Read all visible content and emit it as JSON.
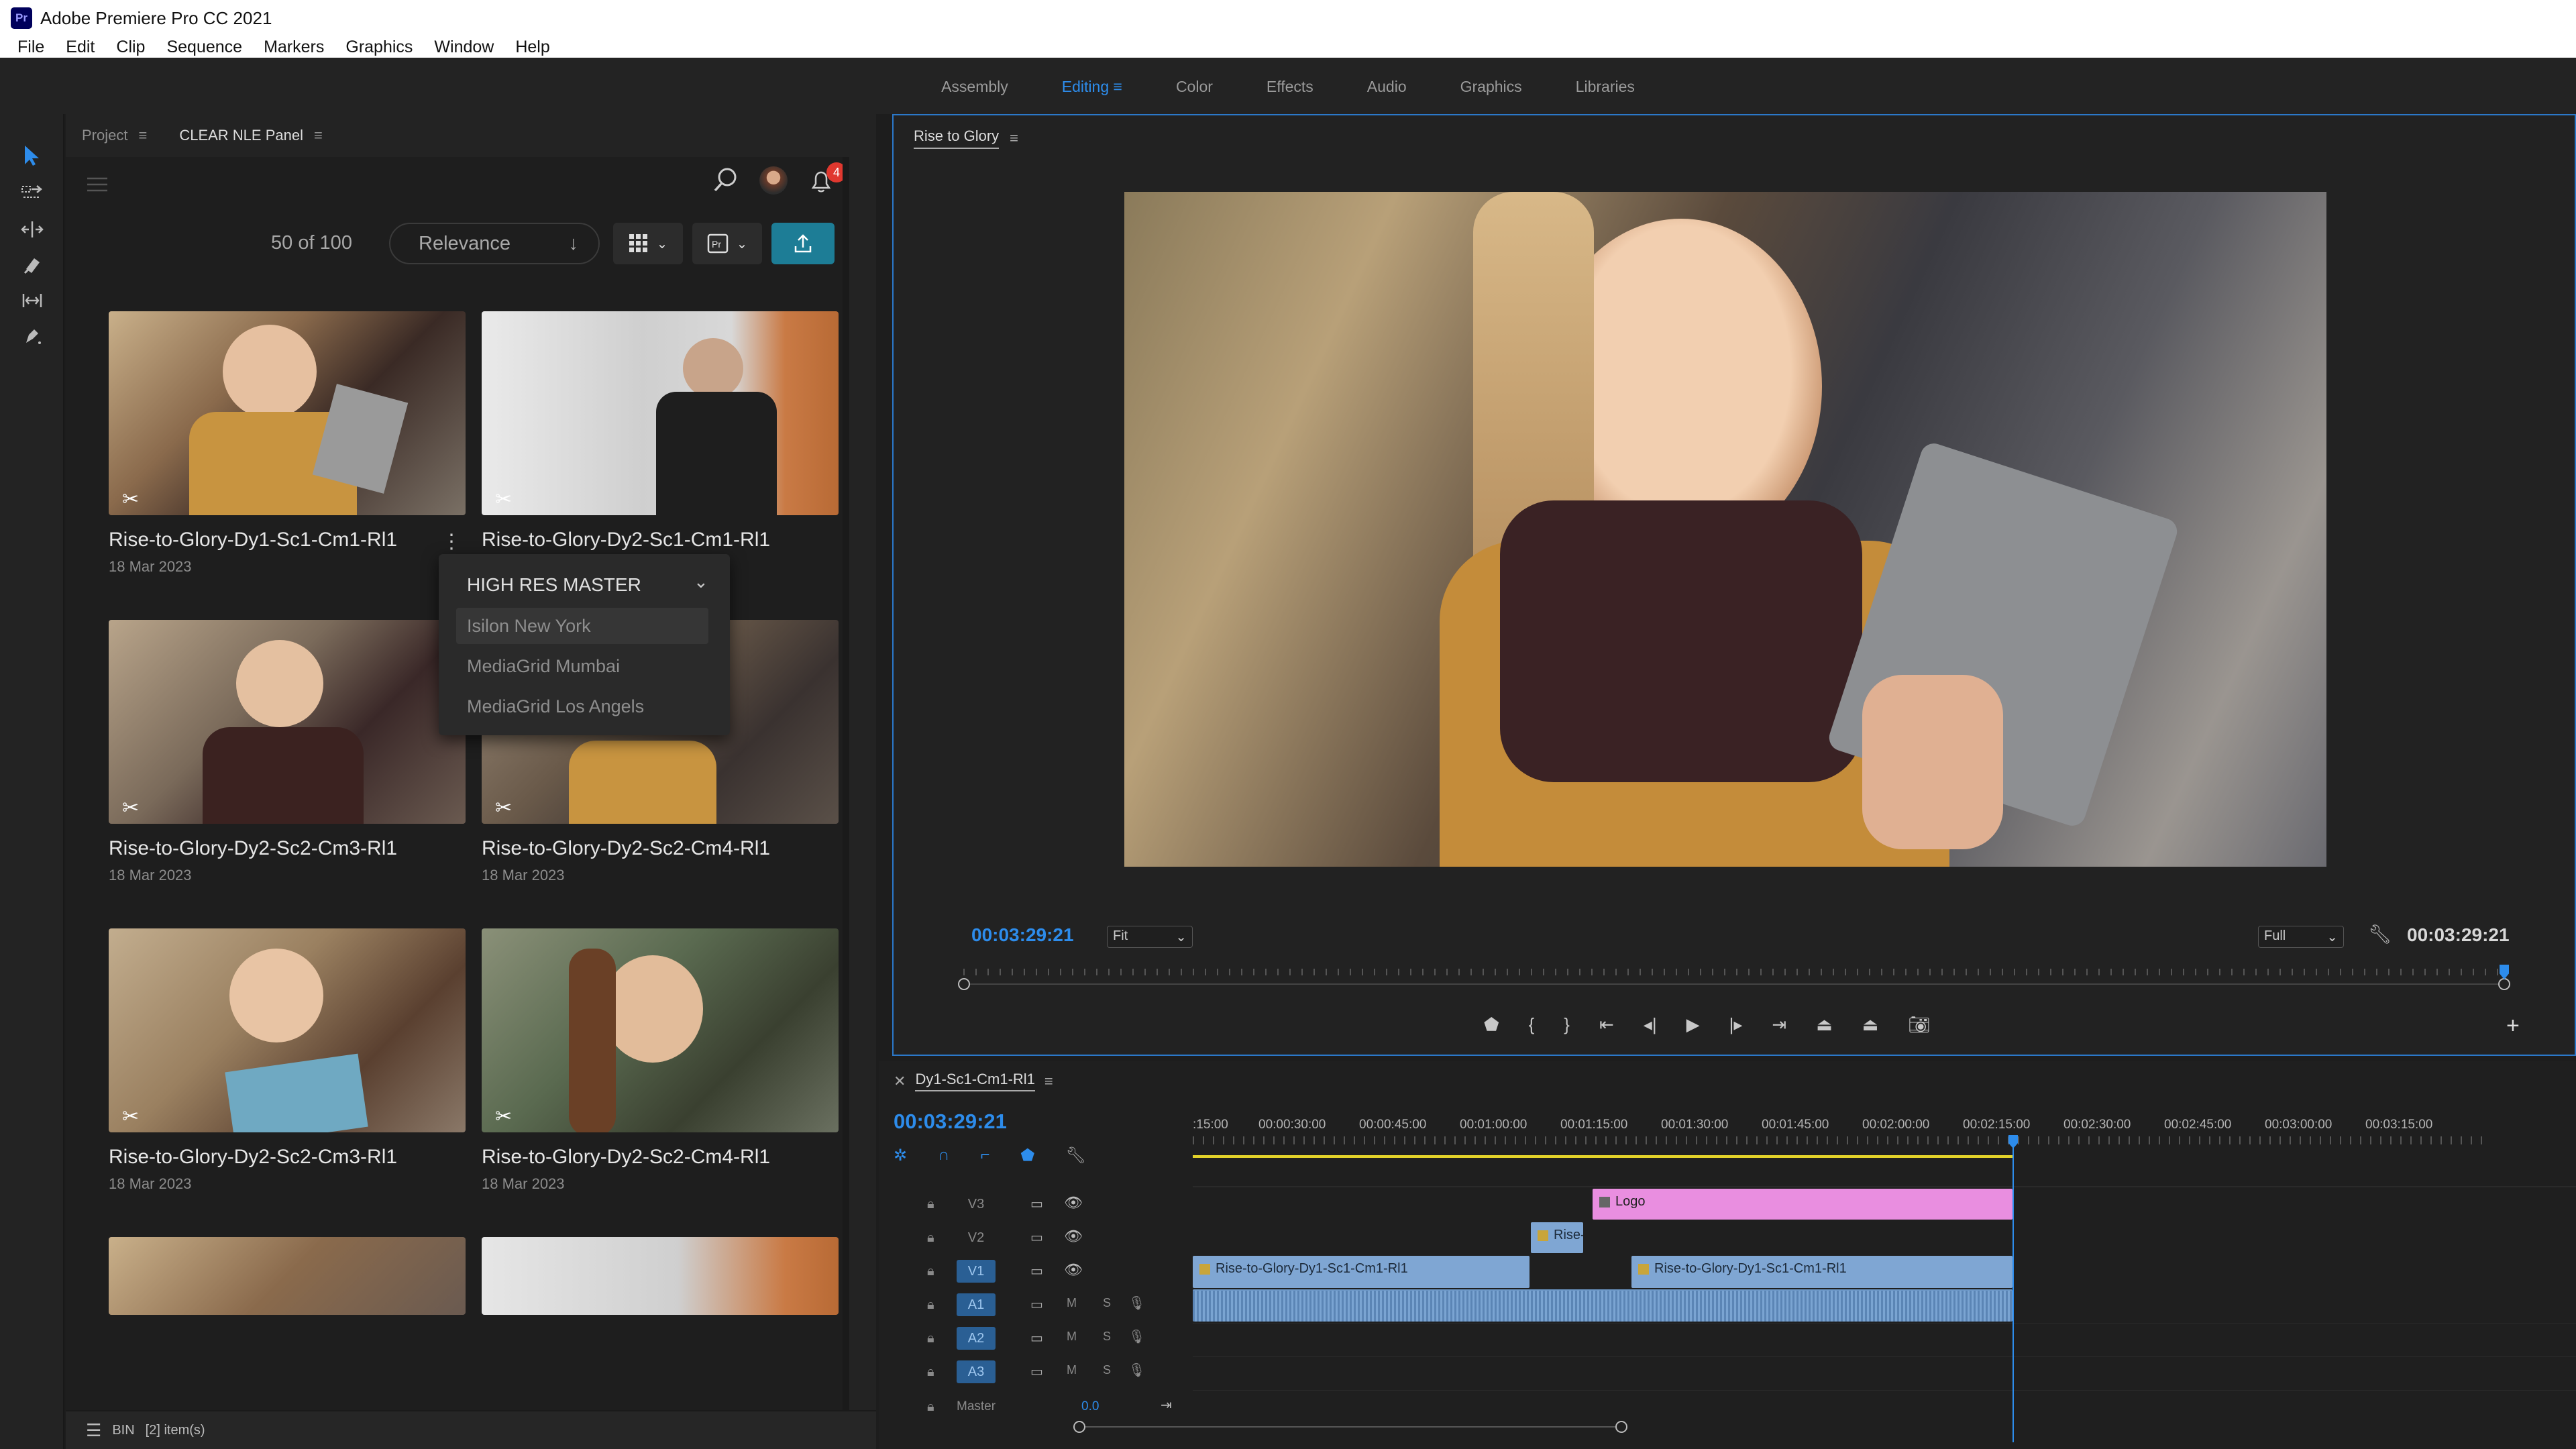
{
  "app": {
    "title": "Adobe Premiere Pro CC 2021",
    "logo_text": "Pr"
  },
  "menu": [
    "File",
    "Edit",
    "Clip",
    "Sequence",
    "Markers",
    "Graphics",
    "Window",
    "Help"
  ],
  "workspaces": {
    "items": [
      "Assembly",
      "Editing",
      "Color",
      "Effects",
      "Audio",
      "Graphics",
      "Libraries"
    ],
    "active": "Editing"
  },
  "left_panel": {
    "tabs": [
      "Project",
      "CLEAR NLE Panel"
    ],
    "count": "50 of 100",
    "sort": "Relevance",
    "notification_count": "4",
    "cards": [
      {
        "title": "Rise-to-Glory-Dy1-Sc1-Cm1-Rl1",
        "date": "18 Mar 2023"
      },
      {
        "title": "Rise-to-Glory-Dy2-Sc1-Cm1-Rl1",
        "date": ""
      },
      {
        "title": "Rise-to-Glory-Dy2-Sc2-Cm3-Rl1",
        "date": "18 Mar 2023"
      },
      {
        "title": "Rise-to-Glory-Dy2-Sc2-Cm4-Rl1",
        "date": "18 Mar 2023"
      },
      {
        "title": "Rise-to-Glory-Dy2-Sc2-Cm3-Rl1",
        "date": "18 Mar 2023"
      },
      {
        "title": "Rise-to-Glory-Dy2-Sc2-Cm4-Rl1",
        "date": "18 Mar 2023"
      }
    ],
    "dropdown": {
      "header": "HIGH RES MASTER",
      "options": [
        "Isilon New York",
        "MediaGrid Mumbai",
        "MediaGrid Los Angels"
      ]
    },
    "status": {
      "bin": "BIN",
      "items": "[2] item(s)"
    }
  },
  "monitor": {
    "tab": "Rise to Glory",
    "timecode_left": "00:03:29:21",
    "fit": "Fit",
    "quality": "Full",
    "timecode_right": "00:03:29:21"
  },
  "timeline": {
    "tab": "Dy1-Sc1-Cm1-Rl1",
    "timecode": "00:03:29:21",
    "ruler": [
      ":15:00",
      "00:00:30:00",
      "00:00:45:00",
      "00:01:00:00",
      "00:01:15:00",
      "00:01:30:00",
      "00:01:45:00",
      "00:02:00:00",
      "00:02:15:00",
      "00:02:30:00",
      "00:02:45:00",
      "00:03:00:00",
      "00:03:15:00"
    ],
    "tracks": [
      "V3",
      "V2",
      "V1",
      "A1",
      "A2",
      "A3"
    ],
    "master": {
      "label": "Master",
      "value": "0.0"
    },
    "audio_buttons": {
      "m": "M",
      "s": "S"
    },
    "clips": {
      "logo": "Logo",
      "v2": "Rise-to-Glor",
      "v1a": "Rise-to-Glory-Dy1-Sc1-Cm1-Rl1",
      "v1b": "Rise-to-Glory-Dy1-Sc1-Cm1-Rl1"
    }
  },
  "colors": {
    "accent": "#2d8ceb",
    "clip_video": "#7fa6d3",
    "clip_graphic": "#e98ee0",
    "export_button": "#1d7d96"
  }
}
